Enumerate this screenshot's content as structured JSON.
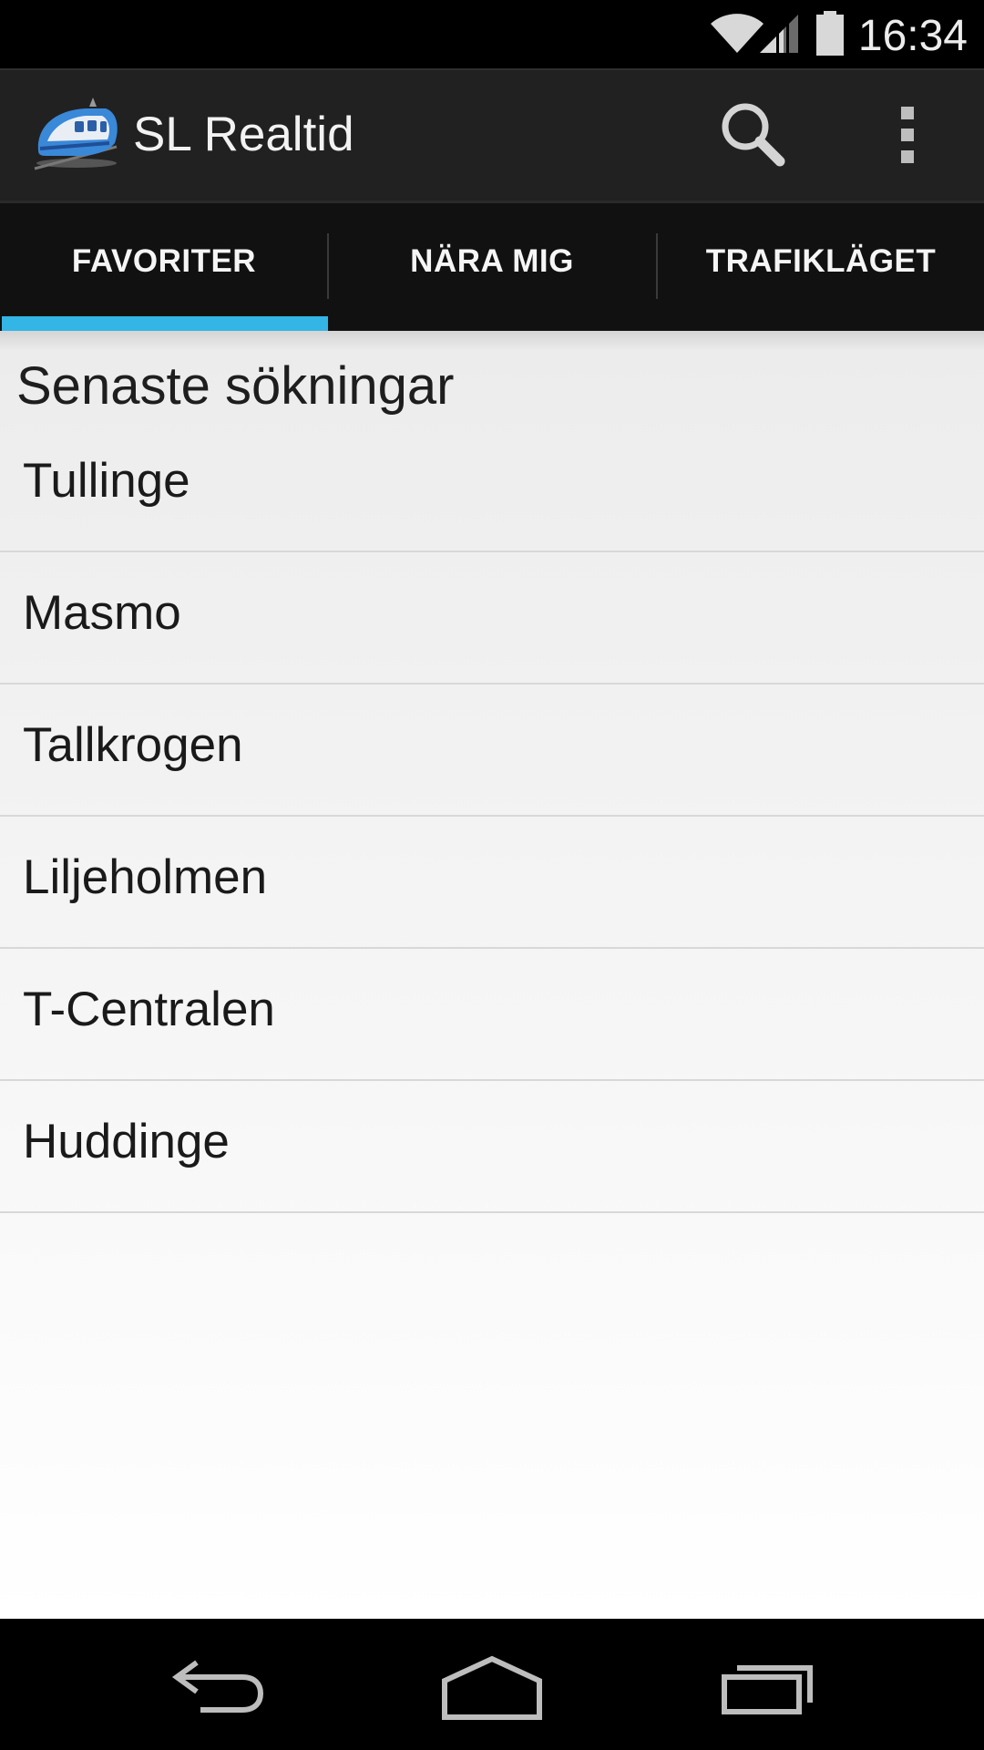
{
  "status_bar": {
    "time": "16:34",
    "icons": [
      "wifi-icon",
      "signal-icon",
      "battery-icon"
    ]
  },
  "action_bar": {
    "title": "SL Realtid",
    "logo_icon": "train-icon",
    "actions": [
      "search-icon",
      "overflow-menu-icon"
    ]
  },
  "tabs": [
    {
      "label": "FAVORITER",
      "selected": true
    },
    {
      "label": "NÄRA MIG",
      "selected": false
    },
    {
      "label": "TRAFIKLÄGET",
      "selected": false
    }
  ],
  "colors": {
    "tab_indicator": "#33b5e5",
    "action_bar": "#212121",
    "tab_bar": "#111111"
  },
  "recent": {
    "heading": "Senaste sökningar",
    "items": [
      {
        "label": "Tullinge"
      },
      {
        "label": "Masmo"
      },
      {
        "label": "Tallkrogen"
      },
      {
        "label": "Liljeholmen"
      },
      {
        "label": "T-Centralen"
      },
      {
        "label": "Huddinge"
      }
    ]
  },
  "nav_bar": {
    "buttons": [
      "back-icon",
      "home-icon",
      "recent-apps-icon"
    ]
  }
}
